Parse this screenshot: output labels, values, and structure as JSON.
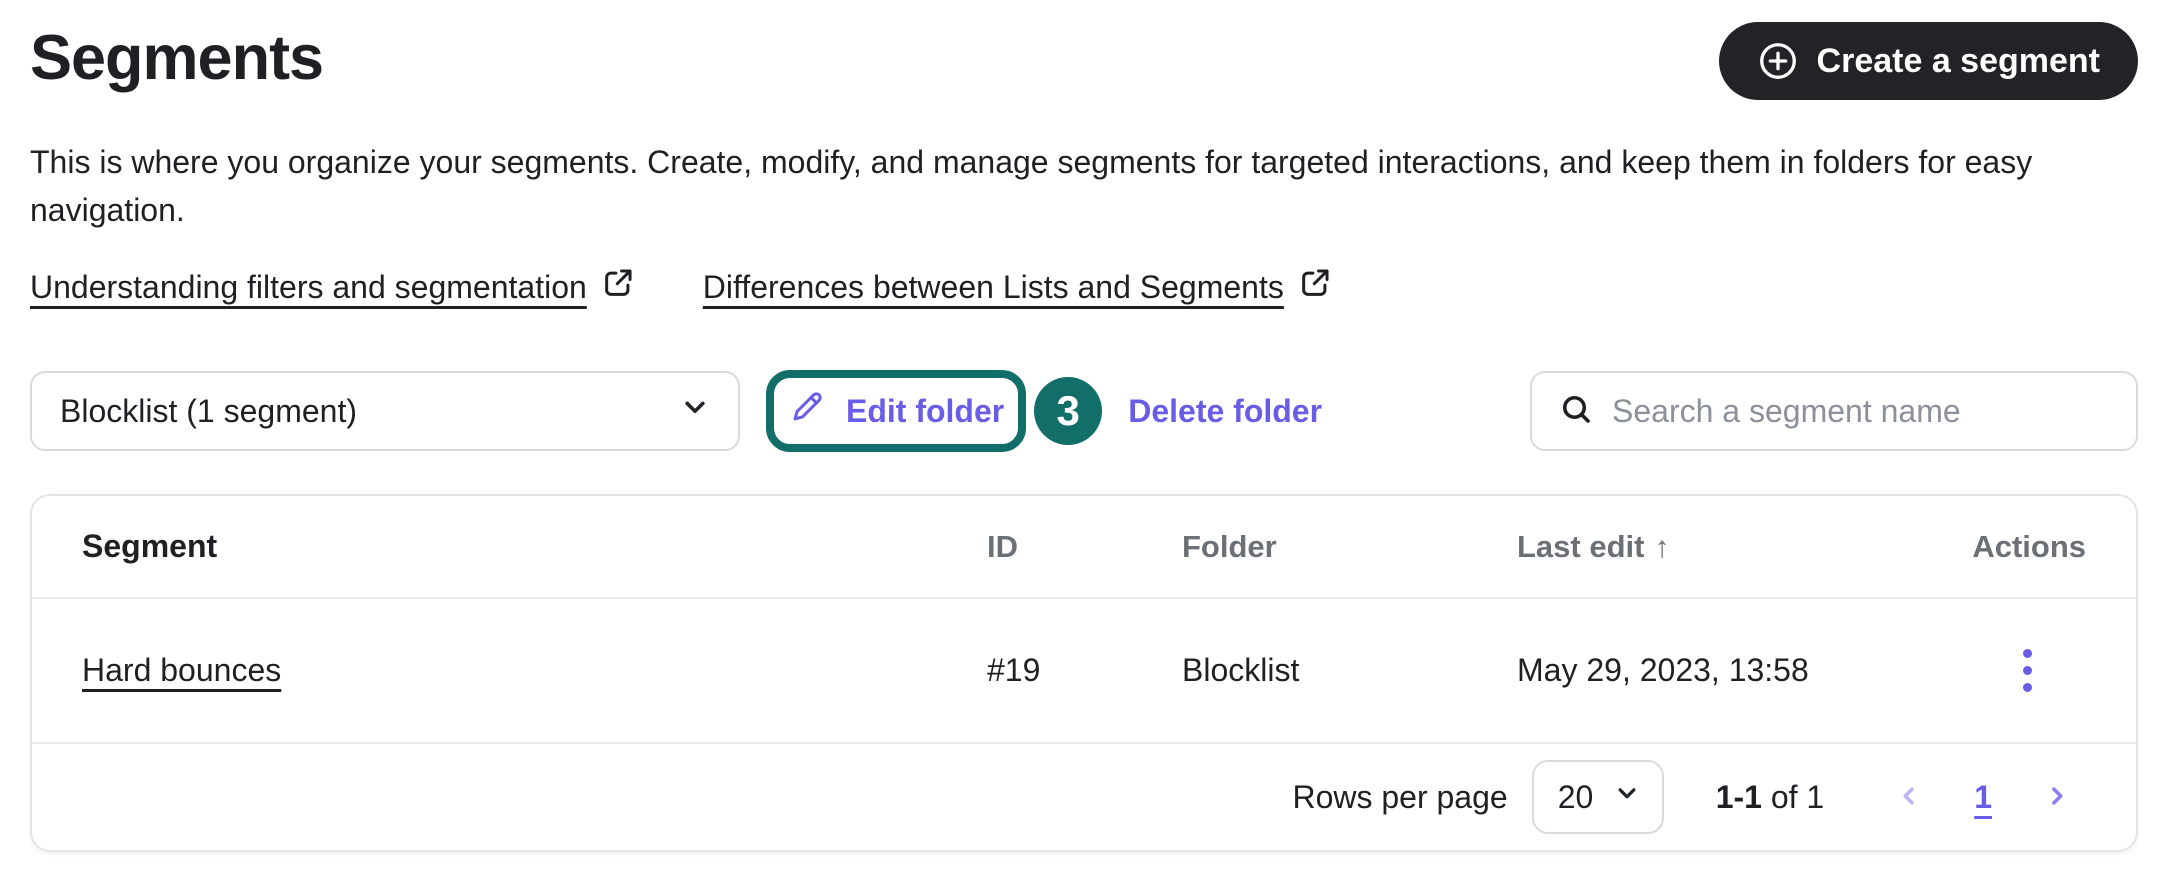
{
  "header": {
    "title": "Segments",
    "create_button_label": "Create a segment",
    "description": "This is where you organize your segments. Create, modify, and manage segments for targeted interactions, and keep them in folders for easy navigation."
  },
  "links": [
    {
      "label": "Understanding filters and segmentation"
    },
    {
      "label": "Differences between Lists and Segments"
    }
  ],
  "toolbar": {
    "folder_select_value": "Blocklist (1 segment)",
    "edit_folder_label": "Edit folder",
    "annotation_badge": "3",
    "delete_folder_label": "Delete folder",
    "search_placeholder": "Search a segment name"
  },
  "table": {
    "headers": [
      "Segment",
      "ID",
      "Folder",
      "Last edit",
      "Actions"
    ],
    "sort_icon": "↑",
    "rows": [
      {
        "segment": "Hard bounces",
        "id": "#19",
        "folder": "Blocklist",
        "last_edit": "May 29, 2023, 13:58"
      }
    ]
  },
  "pagination": {
    "rows_per_page_label": "Rows per page",
    "rows_per_page_value": "20",
    "range_bold": "1-1",
    "range_rest": "of 1",
    "page": "1"
  },
  "colors": {
    "accent_purple": "#695CE6",
    "annotation_teal": "#116E69",
    "button_dark": "#232327",
    "text": "#1F2023",
    "muted_header": "#6B7077",
    "border": "#D7DADE",
    "placeholder": "#8B909A"
  }
}
